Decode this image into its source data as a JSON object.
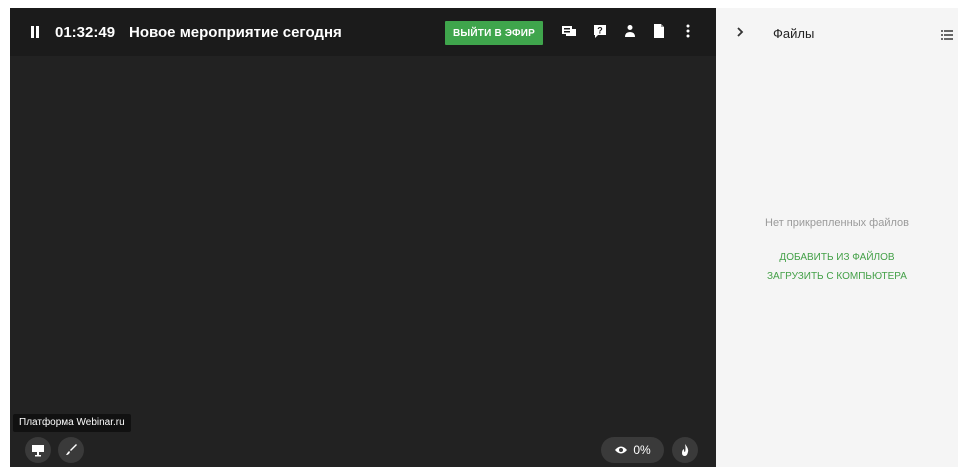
{
  "header": {
    "timer": "01:32:49",
    "event_title": "Новое мероприятие сегодня",
    "exit_label": "ВЫЙТИ В ЭФИР",
    "icons": [
      "pause-icon",
      "chat-icon",
      "question-icon",
      "person-icon",
      "file-icon",
      "more-vertical-icon"
    ]
  },
  "stage": {
    "brand_tooltip": "Платформа Webinar.ru",
    "viewers_percent": "0%",
    "icons": [
      "presentation-icon",
      "brush-icon",
      "eye-icon",
      "flame-icon"
    ]
  },
  "sidebar": {
    "title": "Файлы",
    "empty_text": "Нет прикрепленных файлов",
    "add_from_files": "ДОБАВИТЬ ИЗ ФАЙЛОВ",
    "upload_from_computer": "ЗАГРУЗИТЬ С КОМПЬЮТЕРА",
    "icons": [
      "chevron-right-icon",
      "list-view-icon"
    ]
  },
  "colors": {
    "accent_green": "#3fa54c",
    "link_green": "#43a047",
    "stage_bg": "#222222",
    "sidebar_bg": "#f5f5f5"
  }
}
